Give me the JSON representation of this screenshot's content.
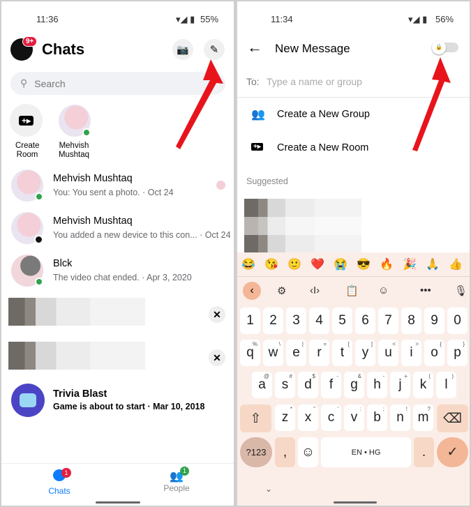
{
  "left": {
    "status": {
      "time": "11:36",
      "battery": "55%"
    },
    "header": {
      "title": "Chats",
      "avatar_badge": "9+",
      "camera_icon": "camera-icon",
      "compose_icon": "pencil-icon"
    },
    "search": {
      "placeholder": "Search"
    },
    "stories": [
      {
        "label1": "Create",
        "label2": "Room"
      },
      {
        "label1": "Mehvish",
        "label2": "Mushtaq"
      }
    ],
    "chats": [
      {
        "name": "Mehvish Mushtaq",
        "preview": "You: You sent a photo. · Oct 24"
      },
      {
        "name": "Mehvish Mushtaq",
        "preview": "You added a new device to this con... · Oct 24"
      },
      {
        "name": "Blck",
        "preview": "The video chat ended. · Apr 3, 2020"
      },
      {
        "name": "Trivia Blast",
        "preview": "Game is about to start · Mar 10, 2018"
      }
    ],
    "nav": [
      {
        "label": "Chats",
        "badge": "1"
      },
      {
        "label": "People",
        "badge": "1"
      }
    ]
  },
  "right": {
    "status": {
      "time": "11:34",
      "battery": "56%"
    },
    "header": {
      "title": "New Message"
    },
    "to": {
      "label": "To:",
      "placeholder": "Type a name or group"
    },
    "actions": [
      {
        "label": "Create a New Group"
      },
      {
        "label": "Create a New Room"
      }
    ],
    "suggested": "Suggested",
    "keyboard": {
      "emojis": [
        "😂",
        "😘",
        "🙂",
        "❤️",
        "😭",
        "😎",
        "🔥",
        "🎉",
        "🙏",
        "👍"
      ],
      "numbers": [
        "1",
        "2",
        "3",
        "4",
        "5",
        "6",
        "7",
        "8",
        "9",
        "0"
      ],
      "row1": [
        "q",
        "w",
        "e",
        "r",
        "t",
        "y",
        "u",
        "i",
        "o",
        "p"
      ],
      "row1_alt": [
        "%",
        "\\",
        "|",
        "=",
        "[",
        "]",
        "<",
        ">",
        "{",
        "}"
      ],
      "row2": [
        "a",
        "s",
        "d",
        "f",
        "g",
        "h",
        "j",
        "k",
        "l"
      ],
      "row2_alt": [
        "@",
        "#",
        "$",
        "-",
        "&",
        "-",
        "+",
        "(",
        ")"
      ],
      "row3": [
        "z",
        "x",
        "c",
        "v",
        "b",
        "n",
        "m"
      ],
      "row3_alt": [
        "*",
        "\"",
        "'",
        ":",
        ";",
        "!",
        "?"
      ],
      "symbols": "?123",
      "comma": ",",
      "space": "EN • HG",
      "period": "."
    }
  },
  "colors": {
    "accent": "#0a7cff",
    "arrow": "#e8141c",
    "online": "#31a24c",
    "badge": "#e41e3f"
  }
}
